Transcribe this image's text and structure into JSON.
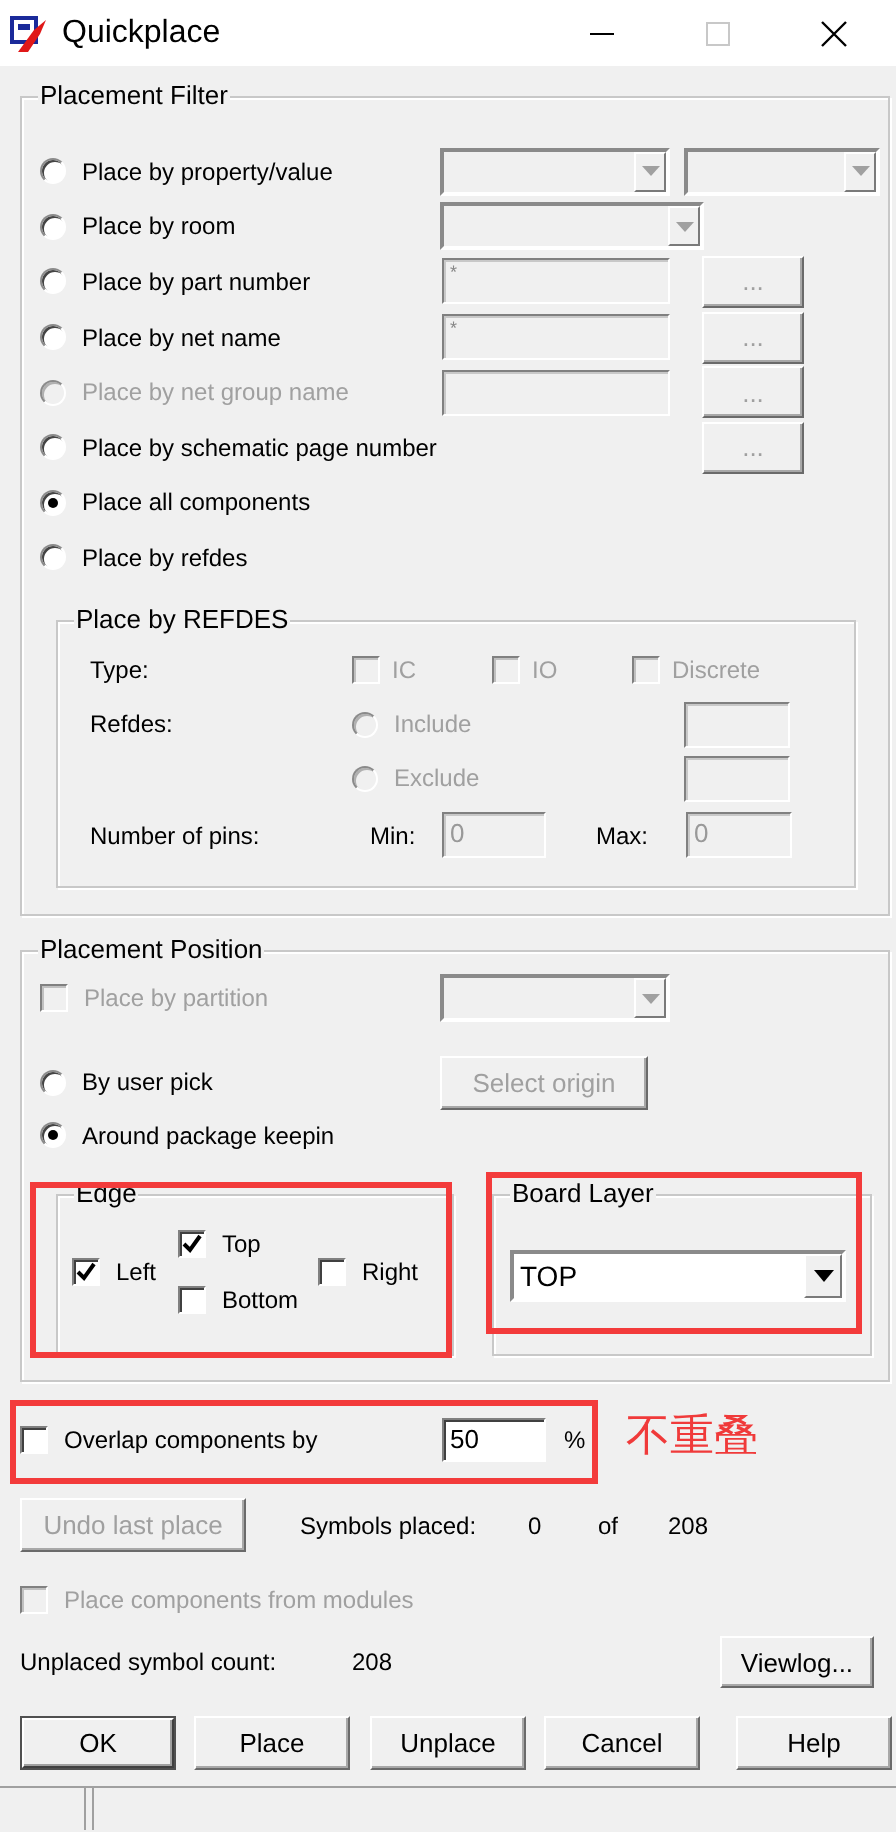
{
  "window": {
    "title": "Quickplace"
  },
  "placement_filter": {
    "title": "Placement Filter",
    "options": [
      {
        "kind": "two-dropdowns",
        "label": "Place by property/value",
        "selected": false,
        "disabled": false
      },
      {
        "kind": "dropdown",
        "label": "Place by room",
        "selected": false,
        "disabled": false
      },
      {
        "kind": "field-browse",
        "label": "Place by part number",
        "selected": false,
        "disabled": false,
        "value": "*",
        "button": "..."
      },
      {
        "kind": "field-browse",
        "label": "Place by net name",
        "selected": false,
        "disabled": false,
        "value": "*",
        "button": "..."
      },
      {
        "kind": "field-browse",
        "label": "Place by net group name",
        "selected": false,
        "disabled": true,
        "button": "..."
      },
      {
        "kind": "browse",
        "label": "Place by schematic page number",
        "selected": false,
        "disabled": false,
        "button": "..."
      },
      {
        "kind": "plain",
        "label": "Place all components",
        "selected": true,
        "disabled": false
      },
      {
        "kind": "plain",
        "label": "Place by refdes",
        "selected": false,
        "disabled": false
      }
    ],
    "refdes": {
      "title": "Place by REFDES",
      "type_label": "Type:",
      "types": [
        {
          "label": "IC",
          "checked": false
        },
        {
          "label": "IO",
          "checked": false
        },
        {
          "label": "Discrete",
          "checked": false
        }
      ],
      "refdes_label": "Refdes:",
      "refdes_options": [
        {
          "label": "Include",
          "selected": false
        },
        {
          "label": "Exclude",
          "selected": false
        }
      ],
      "pins_label": "Number of pins:",
      "min_label": "Min:",
      "min_value": "0",
      "max_label": "Max:",
      "max_value": "0"
    }
  },
  "placement_position": {
    "title": "Placement Position",
    "partition": {
      "label": "Place by partition",
      "checked": false,
      "disabled": true
    },
    "origin_options": [
      {
        "label": "By user pick",
        "selected": false
      },
      {
        "label": "Around package keepin",
        "selected": true
      }
    ],
    "select_origin_button": "Select origin",
    "edge": {
      "title": "Edge",
      "highlighted": true,
      "sides": [
        {
          "label": "Left",
          "checked": true
        },
        {
          "label": "Top",
          "checked": true
        },
        {
          "label": "Bottom",
          "checked": false
        },
        {
          "label": "Right",
          "checked": false
        }
      ]
    },
    "board_layer": {
      "title": "Board Layer",
      "value": "TOP",
      "highlighted": true
    }
  },
  "overlap": {
    "label": "Overlap components by",
    "checked": false,
    "value": "50",
    "unit": "%",
    "highlighted": true,
    "note": "不重叠"
  },
  "undo_button": {
    "label": "Undo last place",
    "disabled": true
  },
  "symbols_placed": {
    "label": "Symbols placed:",
    "placed": "0",
    "of": "of",
    "total": "208"
  },
  "modules": {
    "label": "Place components from modules",
    "checked": false,
    "disabled": true
  },
  "unplaced": {
    "label": "Unplaced symbol count:",
    "value": "208"
  },
  "viewlog_button": "Viewlog...",
  "buttons": [
    {
      "label": "OK",
      "default": true
    },
    {
      "label": "Place",
      "default": false
    },
    {
      "label": "Unplace",
      "default": false
    },
    {
      "label": "Cancel",
      "default": false
    },
    {
      "label": "Help",
      "default": false
    }
  ]
}
